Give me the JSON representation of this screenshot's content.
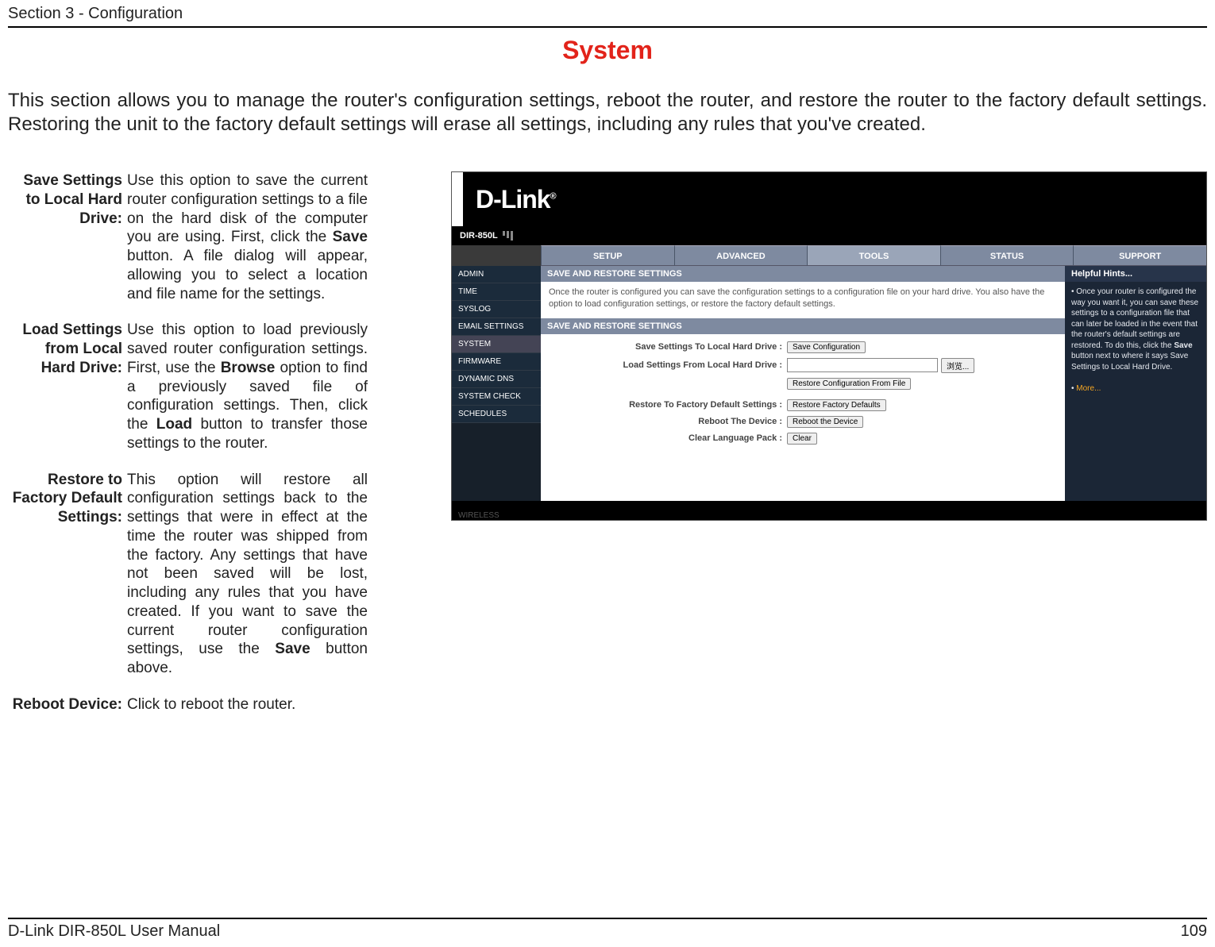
{
  "header": {
    "section": "Section 3 - Configuration"
  },
  "title": "System",
  "intro": "This section allows you to manage the router's configuration settings, reboot the router, and restore the router to the factory default settings. Restoring the unit to the factory default settings will erase all settings, including any rules that you've created.",
  "defs": {
    "save": {
      "label": "Save Settings to Local Hard Drive:",
      "p1": "Use this option to save the current router configuration settings to a file on the hard disk of the computer you are using. First, click the ",
      "b1": "Save",
      "p2": " button. A file dialog will appear, allowing you to select a location and file name for the settings."
    },
    "load": {
      "label": "Load Settings from Local Hard Drive:",
      "p1": "Use this option to load previously saved router configuration settings. First, use the ",
      "b1": "Browse",
      "p2": " option to find a previously saved file of configuration settings. Then, click the ",
      "b2": "Load",
      "p3": " button to transfer those settings to the router."
    },
    "restore": {
      "label": "Restore to Factory Default Settings:",
      "p1": "This option will restore all configuration settings back to the settings that were in effect at the time the router was shipped from the factory. Any settings that have not been saved will be lost, including any rules that you have created. If you want to save the current router configuration settings, use the ",
      "b1": "Save",
      "p2": " button above."
    },
    "reboot": {
      "label": "Reboot Device:",
      "p1": "Click to reboot the router."
    }
  },
  "router": {
    "logo": "D-Link",
    "model": "DIR-850L",
    "nav": [
      "SETUP",
      "ADVANCED",
      "TOOLS",
      "STATUS",
      "SUPPORT"
    ],
    "side": [
      "ADMIN",
      "TIME",
      "SYSLOG",
      "EMAIL SETTINGS",
      "SYSTEM",
      "FIRMWARE",
      "DYNAMIC DNS",
      "SYSTEM CHECK",
      "SCHEDULES"
    ],
    "panel1": {
      "head": "SAVE AND RESTORE SETTINGS",
      "desc": "Once the router is configured you can save the configuration settings to a configuration file on your hard drive. You also have the option to load configuration settings, or restore the factory default settings."
    },
    "panel2": {
      "head": "SAVE AND RESTORE SETTINGS",
      "rows": {
        "save": {
          "label": "Save Settings To Local Hard Drive  :",
          "btn": "Save Configuration"
        },
        "load": {
          "label": "Load Settings From Local Hard Drive  :",
          "browse": "浏览...",
          "restorebtn": "Restore Configuration From File"
        },
        "factory": {
          "label": "Restore To Factory Default Settings  :",
          "btn": "Restore Factory Defaults"
        },
        "reboot": {
          "label": "Reboot The Device  :",
          "btn": "Reboot the Device"
        },
        "clear": {
          "label": "Clear Language Pack  :",
          "btn": "Clear"
        }
      }
    },
    "hints": {
      "head": "Helpful Hints...",
      "bullet1": "Once your router is configured the way you want it, you can save these settings to a configuration file that can later be loaded in the event that the router's default settings are restored. To do this, click the ",
      "bold1": "Save",
      "bullet1b": " button next to where it says Save Settings to Local Hard Drive.",
      "more": "More..."
    },
    "footerText": "WIRELESS"
  },
  "footer": {
    "left": "D-Link DIR-850L User Manual",
    "right": "109"
  }
}
